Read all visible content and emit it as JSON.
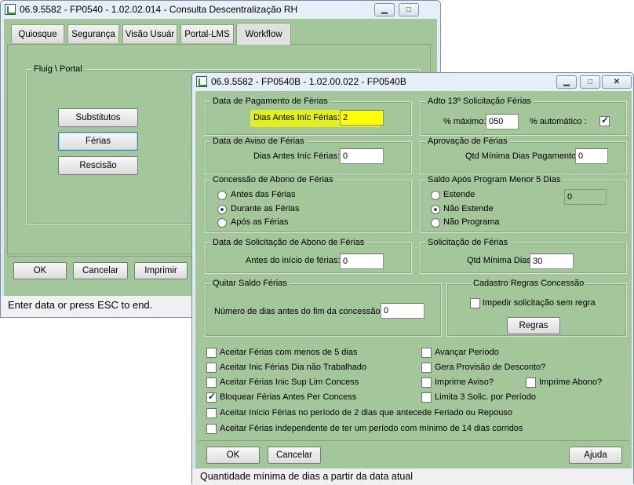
{
  "back_window": {
    "title": "06.9.5582 - FP0540 - 1.02.02.014 - Consulta Descentralização RH",
    "tabs": [
      "Quiosque",
      "Segurança",
      "Visão Usuár",
      "Portal-LMS",
      "Workflow"
    ],
    "active_tab": "Workflow",
    "group_label": "Fluig \\ Portal",
    "buttons": {
      "substitutos": "Substitutos",
      "ferias": "Férias",
      "rescisao": "Rescisão"
    },
    "footer": {
      "ok": "OK",
      "cancelar": "Cancelar",
      "imprimir": "Imprimir"
    },
    "status": "Enter data or press ESC to end."
  },
  "dialog": {
    "title": "06.9.5582 - FP0540B - 1.02.00.022 - FP0540B",
    "pagamento": {
      "legend": "Data de Pagamento de Férias",
      "label": "Dias Antes Iníc Férias:",
      "value": "2"
    },
    "adto13": {
      "legend": "Adto 13º Solicitação Férias",
      "maximo_label": "% máximo:",
      "maximo_value": "050",
      "automatico_label": "% automático :",
      "automatico_checked": true
    },
    "aviso": {
      "legend": "Data de Aviso de Férias",
      "label": "Dias Antes Iníc Férias:",
      "value": "0"
    },
    "aprovacao": {
      "legend": "Aprovação de Férias",
      "label": "Qtd Mínima Dias Pagamento:",
      "value": "0"
    },
    "abono": {
      "legend": "Concessão de Abono de Férias",
      "options": [
        "Antes das Férias",
        "Durante as Férias",
        "Após as Férias"
      ],
      "selected": "Durante as Férias"
    },
    "saldo": {
      "legend": "Saldo Após Program Menor 5 Dias",
      "options": [
        "Estende",
        "Não Estende",
        "Não Programa"
      ],
      "selected": "Não Estende",
      "readonly_value": "0"
    },
    "solic_abono": {
      "legend": "Data de Solicitação de Abono de Férias",
      "label": "Antes do início de férias:",
      "value": "0"
    },
    "solic_ferias": {
      "legend": "Solicitação de Férias",
      "label": "Qtd Mínima Dias:",
      "value": "30"
    },
    "quitar": {
      "legend": "Quitar Saldo Férias",
      "label": "Número de dias antes do fim da concessão:",
      "value": "0"
    },
    "cadastro": {
      "legend": "Cadastro Regras Concessão",
      "checkbox_label": "Impedir solicitação sem regra",
      "checkbox_checked": false,
      "regras_button": "Regras"
    },
    "checks_left": [
      {
        "label": "Aceitar Férias com menos de 5 dias",
        "checked": false
      },
      {
        "label": "Aceitar Inic Férias Dia não Trabalhado",
        "checked": false
      },
      {
        "label": "Aceitar Férias Inic Sup Lim Concess",
        "checked": false
      },
      {
        "label": "Bloquear Férias Antes Per Concess",
        "checked": true
      }
    ],
    "checks_right": [
      {
        "label": "Avançar Período",
        "checked": false
      },
      {
        "label": "Gera Provisão de Desconto?",
        "checked": false
      },
      {
        "label": "Imprime Aviso?",
        "checked": false
      },
      {
        "label": "Limita 3 Solic. por Período",
        "checked": false
      }
    ],
    "imprime_abono": {
      "label": "Imprime Abono?",
      "checked": false
    },
    "checks_wide": [
      {
        "label": "Aceitar Início Férias no período de 2 dias que antecede Feriado ou Repouso",
        "checked": false
      },
      {
        "label": "Aceitar Férias independente de ter um período com mínimo de 14 dias corridos",
        "checked": false
      }
    ],
    "footer": {
      "ok": "OK",
      "cancelar": "Cancelar",
      "ajuda": "Ajuda"
    },
    "status": "Quantidade mínima de dias a partir da data atual"
  },
  "colors": {
    "panel_green": "#a4c69b",
    "highlight_yellow": "#ffff00"
  }
}
